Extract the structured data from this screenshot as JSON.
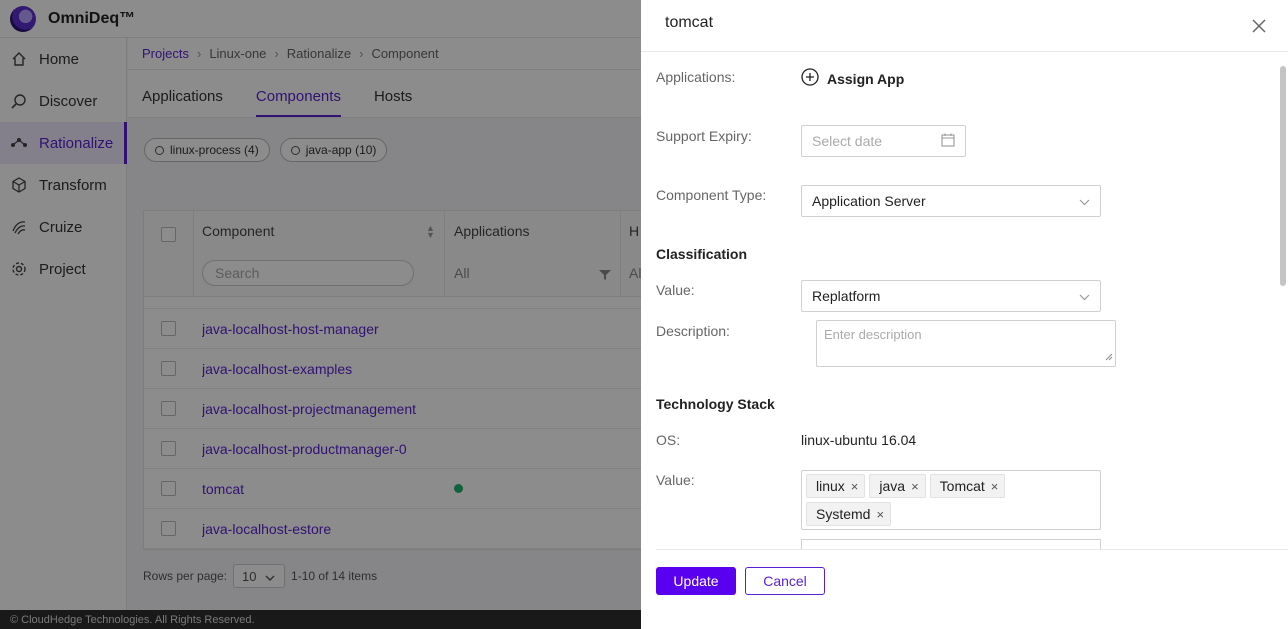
{
  "app": {
    "brand": "OmniDeq™"
  },
  "sidebar": {
    "items": [
      {
        "label": "Home",
        "icon": "home-icon"
      },
      {
        "label": "Discover",
        "icon": "discover-icon"
      },
      {
        "label": "Rationalize",
        "icon": "rationalize-icon",
        "active": true
      },
      {
        "label": "Transform",
        "icon": "cube-icon"
      },
      {
        "label": "Cruize",
        "icon": "cruize-icon"
      },
      {
        "label": "Project",
        "icon": "gear-icon"
      }
    ]
  },
  "breadcrumb": [
    "Projects",
    "Linux-one",
    "Rationalize",
    "Component"
  ],
  "tabs": [
    "Applications",
    "Components",
    "Hosts"
  ],
  "chips": [
    "linux-process (4)",
    "java-app (10)"
  ],
  "table": {
    "headers": {
      "component": "Component",
      "applications": "Applications",
      "hosts": "H"
    },
    "search_placeholder": "Search",
    "applications_filter": "All",
    "hosts_filter": "Al",
    "rows": [
      "java-localhost-host-manager",
      "java-localhost-examples",
      "java-localhost-projectmanagement",
      "java-localhost-productmanager-0",
      "tomcat",
      "java-localhost-estore"
    ]
  },
  "pager": {
    "label": "Rows per page:",
    "value": "10",
    "summary": "1-10 of 14 items"
  },
  "footer": "© CloudHedge Technologies. All Rights Reserved.",
  "drawer": {
    "title": "tomcat",
    "applications_label": "Applications:",
    "assign_app": "Assign App",
    "support_expiry_label": "Support Expiry:",
    "support_expiry_placeholder": "Select date",
    "component_type_label": "Component Type:",
    "component_type_value": "Application Server",
    "classification_heading": "Classification",
    "value_label": "Value:",
    "classification_value": "Replatform",
    "description_label": "Description:",
    "description_placeholder": "Enter description",
    "tech_stack_heading": "Technology Stack",
    "os_label": "OS:",
    "os_value": "linux-ubuntu 16.04",
    "tech_value_label": "Value:",
    "tags": [
      "linux",
      "java",
      "Tomcat",
      "Systemd"
    ],
    "update_label": "Update",
    "cancel_label": "Cancel"
  },
  "colors": {
    "accent": "#5a1fd1",
    "primary_button": "#5a00f0",
    "status_green": "#1db36b"
  }
}
